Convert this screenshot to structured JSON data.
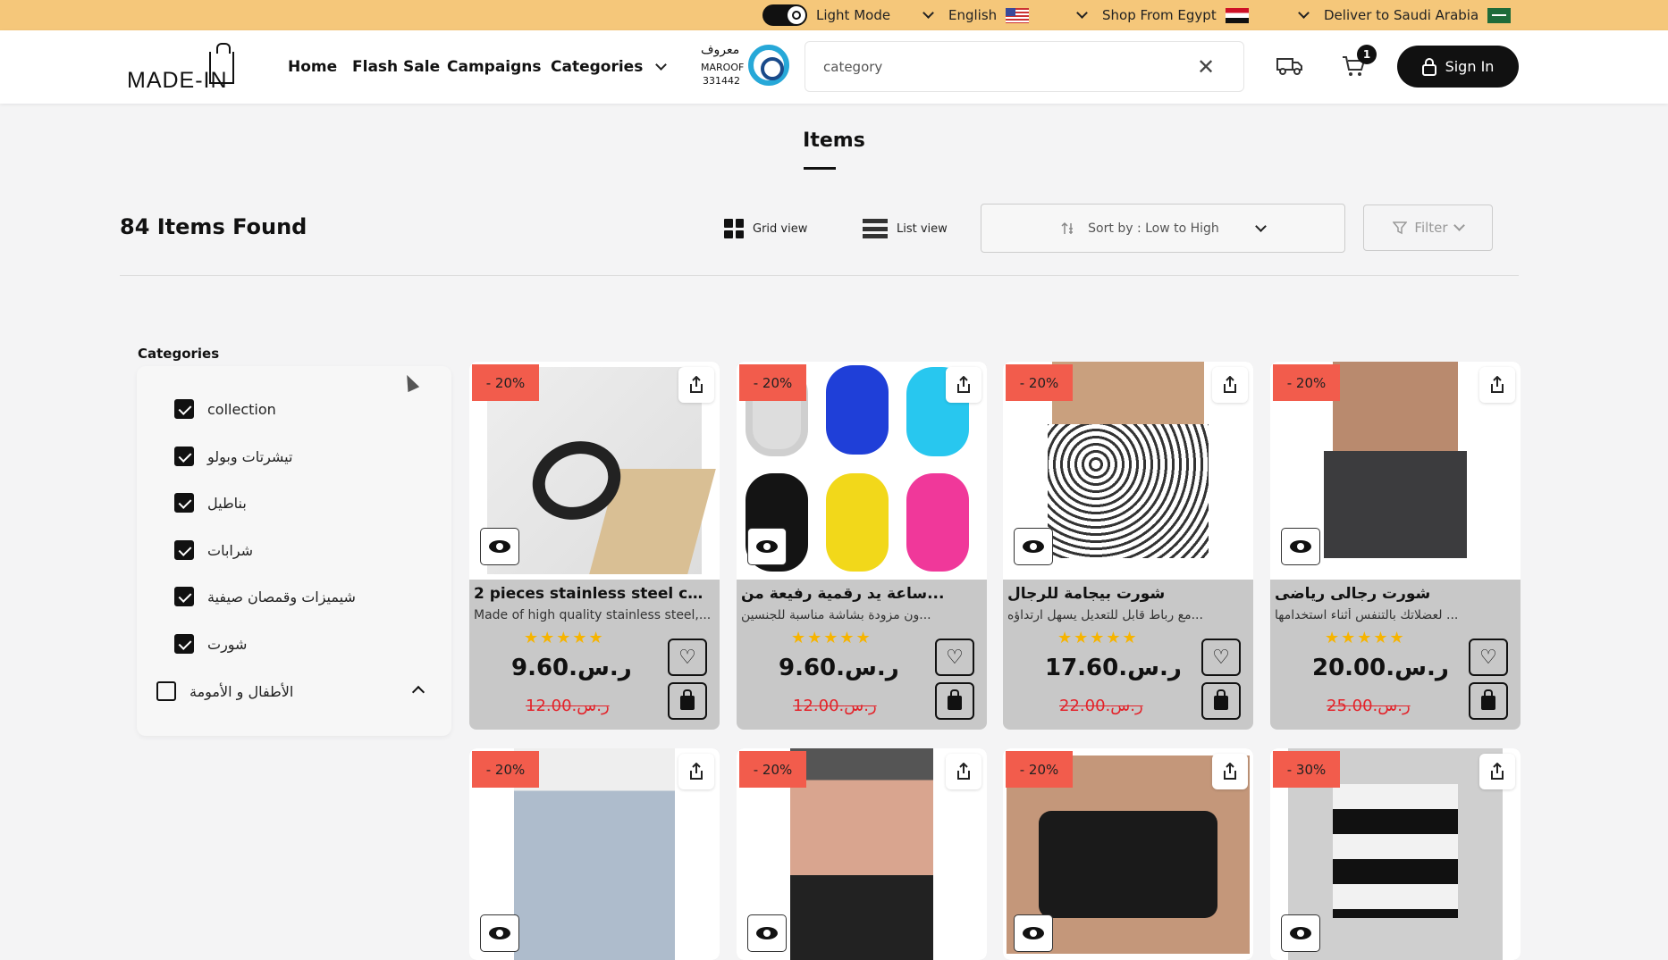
{
  "topbar": {
    "theme_label": "Light Mode",
    "language_label": "English",
    "shop_from_label": "Shop From Egypt",
    "deliver_to_label": "Deliver to Saudi Arabia"
  },
  "header": {
    "logo_text": "MADE-IN",
    "nav": [
      "Home",
      "Flash Sale",
      "Campaigns",
      "Categories"
    ],
    "maroof": {
      "arabic": "معروف",
      "latin": "MAROOF",
      "number": "331442"
    },
    "search_value": "category",
    "cart_count": "1",
    "signin_label": "Sign In"
  },
  "page": {
    "title": "Items",
    "found_label": "84 Items Found",
    "grid_view_label": "Grid view",
    "list_view_label": "List view",
    "sort_label": "Sort by : Low to High",
    "filter_label": "Filter"
  },
  "categories": {
    "title": "Categories",
    "items": [
      {
        "label": "collection",
        "checked": true
      },
      {
        "label": "تيشرتات وبولو",
        "checked": true
      },
      {
        "label": "بناطيل",
        "checked": true
      },
      {
        "label": "شرابات",
        "checked": true
      },
      {
        "label": "شيميزات وقمصان صيفية",
        "checked": true
      },
      {
        "label": "شورت",
        "checked": true
      },
      {
        "label": "الأطفال و الأمومة",
        "checked": false
      }
    ]
  },
  "products": [
    {
      "discount": "- 20%",
      "name": "2 pieces stainless steel chain...",
      "desc": "Made of high quality stainless steel,...",
      "price": "9.60.ر.س",
      "old_price": "12.00.ر.س",
      "rating": 5
    },
    {
      "discount": "- 20%",
      "name": "ساعة يد رقمية رفيعة من...",
      "desc": "ون مزودة بشاشة مناسبة للجنسين...",
      "price": "9.60.ر.س",
      "old_price": "12.00.ر.س",
      "rating": 5
    },
    {
      "discount": "- 20%",
      "name": "شورت بيجامة للرجال",
      "desc": "مع رباط قابل للتعديل يسهل ارتداؤه...",
      "price": "17.60.ر.س",
      "old_price": "22.00.ر.س",
      "rating": 5
    },
    {
      "discount": "- 20%",
      "name": "شورت رجالى رياضى",
      "desc": "لعضلاتك بالتنفس أثناء استخدامها ...",
      "price": "20.00.ر.س",
      "old_price": "25.00.ر.س",
      "rating": 5
    },
    {
      "discount": "- 20%"
    },
    {
      "discount": "- 20%"
    },
    {
      "discount": "- 20%"
    },
    {
      "discount": "- 30%"
    }
  ],
  "colors": {
    "topbar": "#f5c77a",
    "discount": "#f25c4c",
    "rating": "#f6b400",
    "old_price": "#e3232a"
  }
}
